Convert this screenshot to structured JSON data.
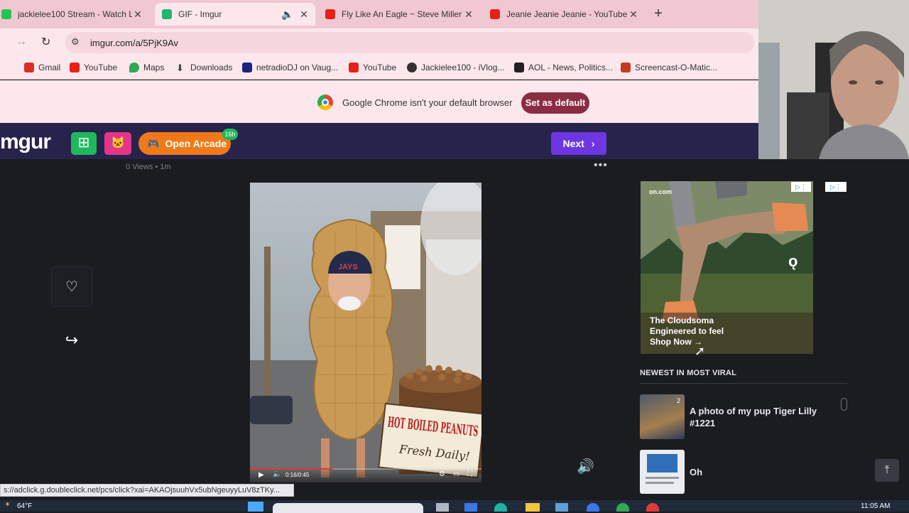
{
  "tabs": [
    {
      "title": "jackielee100 Stream - Watch Liv",
      "color": "#23c653"
    },
    {
      "title": "GIF - Imgur",
      "color": "#1bb76e"
    },
    {
      "title": "Fly Like An Eagle ~ Steve Miller",
      "color": "#e62117"
    },
    {
      "title": "Jeanie Jeanie Jeanie - YouTube",
      "color": "#e62117"
    }
  ],
  "address": {
    "url": "imgur.com/a/5PjK9Av"
  },
  "bookmarks": [
    {
      "label": "Gmail",
      "color": "#d93025"
    },
    {
      "label": "YouTube",
      "color": "#e62117"
    },
    {
      "label": "Maps",
      "color": "#34a853"
    },
    {
      "label": "Downloads",
      "color": "#444444"
    },
    {
      "label": "netradioDJ on Vaug...",
      "color": "#1a237e"
    },
    {
      "label": "YouTube",
      "color": "#e62117"
    },
    {
      "label": "Jackielee100 - iVlog...",
      "color": "#333333"
    },
    {
      "label": "AOL - News, Politics...",
      "color": "#222222"
    },
    {
      "label": "Screencast-O-Matic...",
      "color": "#c43a1a"
    }
  ],
  "infobar": {
    "message": "Google Chrome isn't your default browser",
    "button": "Set as default"
  },
  "imgur": {
    "logo": "mgur",
    "arcade_label": "Open Arcade",
    "arcade_badge": "16h",
    "next_label": "Next",
    "brand_color": "#6d36e0"
  },
  "post": {
    "meta": "0 Views • 1m",
    "sign_text": "HOT BOILED PEANUTS",
    "sign_sub": "Fresh Daily!",
    "cap_text": "JAYS",
    "video_time": "0:16/0:45",
    "video_progress": 0.36
  },
  "ad": {
    "brand": "on.com",
    "line1": "The Cloudsoma",
    "line2": "Engineered to feel",
    "cta": "Shop Now →"
  },
  "sidebar": {
    "heading": "NEWEST IN MOST VIRAL",
    "items": [
      {
        "title": "A photo of my pup Tiger Lilly #1221",
        "count": "2"
      },
      {
        "title": "Oh"
      }
    ]
  },
  "status_url": "s://adclick.g.doubleclick.net/pcs/click?xai=AKAOjsuuhVx5ubNgeuyyLuV8zTKy...",
  "taskbar": {
    "weather": "64°F",
    "clock": "11:05 AM"
  }
}
